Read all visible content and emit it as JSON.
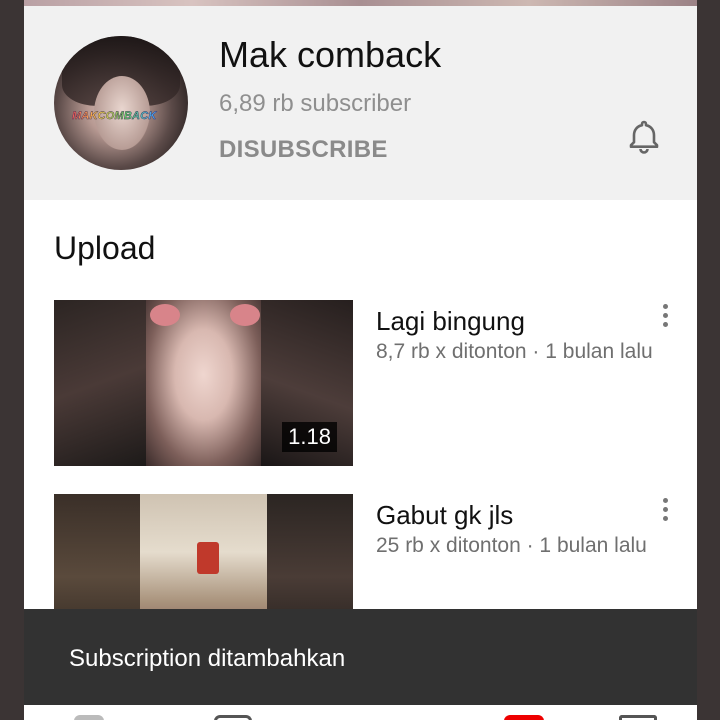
{
  "channel": {
    "name": "Mak comback",
    "subscriber_count": "6,89 rb subscriber",
    "unsubscribe_label": "DISUBSCRIBE",
    "avatar_logo_text": "MAKCOMBACK"
  },
  "section": {
    "title": "Upload"
  },
  "videos": [
    {
      "title": "Lagi bingung",
      "meta": "8,7 rb x ditonton · 1 bulan lalu",
      "duration": "1.18"
    },
    {
      "title": "Gabut gk jls",
      "meta": "25 rb x ditonton · 1 bulan lalu"
    }
  ],
  "snackbar": {
    "text": "Subscription ditambahkan"
  },
  "icons": {
    "notification": "bell-icon",
    "more": "more-vertical-icon"
  },
  "colors": {
    "header_bg": "#f1f1f1",
    "snackbar_bg": "#323232",
    "accent": "#ee0000"
  }
}
